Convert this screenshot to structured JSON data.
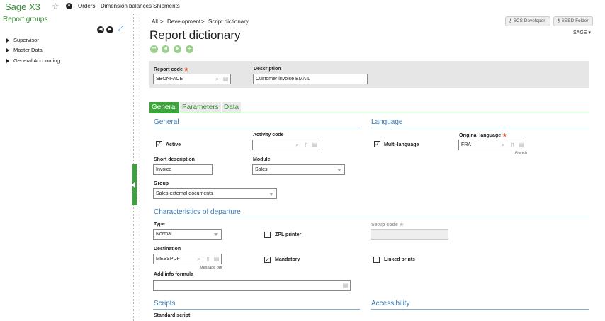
{
  "app": {
    "title": "Sage X3"
  },
  "topmenu": [
    "Orders",
    "Dimension balances",
    "Shipments"
  ],
  "sidebar": {
    "title": "Report groups",
    "items": [
      {
        "label": "Supervisor"
      },
      {
        "label": "Master Data"
      },
      {
        "label": "General Accounting"
      }
    ]
  },
  "breadcrumb": [
    "All",
    "Development",
    "Script dictionary"
  ],
  "page_title": "Report dictionary",
  "header_buttons": {
    "developer": "SCS Developer",
    "folder": "SEED Folder",
    "sage_menu": "SAGE"
  },
  "header": {
    "report_code": {
      "label": "Report code",
      "value": "SBONFACE"
    },
    "description": {
      "label": "Description",
      "value": "Customer invoice EMAIL"
    }
  },
  "tabs": [
    {
      "label": "General",
      "active": true
    },
    {
      "label": "Parameters",
      "active": false
    },
    {
      "label": "Data",
      "active": false
    }
  ],
  "general": {
    "section_title": "General",
    "active": {
      "label": "Active",
      "checked": true
    },
    "activity_code": {
      "label": "Activity code",
      "value": ""
    },
    "short_description": {
      "label": "Short description",
      "value": "Invoice"
    },
    "module": {
      "label": "Module",
      "value": "Sales"
    },
    "group": {
      "label": "Group",
      "value": "Sales external documents"
    }
  },
  "language": {
    "section_title": "Language",
    "multi_language": {
      "label": "Multi-language",
      "checked": true
    },
    "original_language": {
      "label": "Original language",
      "value": "FRA",
      "hint": "French"
    }
  },
  "departure": {
    "section_title": "Characteristics of departure",
    "type": {
      "label": "Type",
      "value": "Normal"
    },
    "zpl_printer": {
      "label": "ZPL printer",
      "checked": false
    },
    "setup_code": {
      "label": "Setup code",
      "value": ""
    },
    "destination": {
      "label": "Destination",
      "value": "MESSPDF",
      "hint": "Message pdf"
    },
    "mandatory": {
      "label": "Mandatory",
      "checked": true
    },
    "linked_prints": {
      "label": "Linked prints",
      "checked": false
    },
    "add_info_formula": {
      "label": "Add info formula",
      "value": ""
    }
  },
  "scripts": {
    "section_title": "Scripts",
    "standard_script": {
      "label": "Standard script"
    }
  },
  "accessibility": {
    "section_title": "Accessibility"
  },
  "colors": {
    "brand_green": "#3aa63a",
    "section_blue": "#3a7ab0",
    "required": "#e0502a"
  },
  "icons": [
    "star-icon",
    "chevron-down-icon",
    "prev-icon",
    "next-icon",
    "expand-icon",
    "first-record-icon",
    "previous-record-icon",
    "next-record-icon",
    "last-record-icon",
    "search-icon",
    "tunnel-icon",
    "selection-icon",
    "key-icon",
    "folder-icon"
  ]
}
